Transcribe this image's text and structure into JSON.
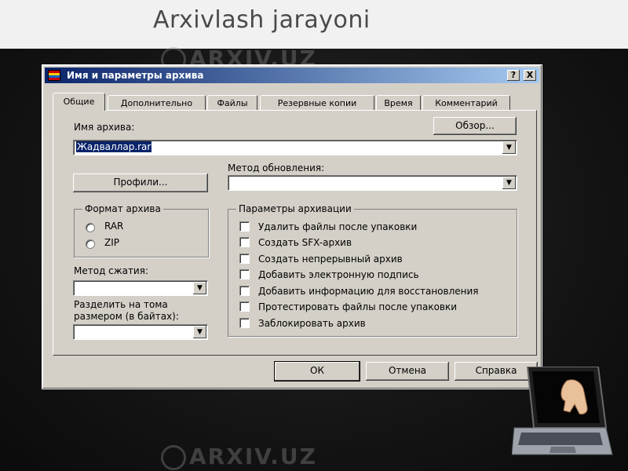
{
  "slide": {
    "title": "Arxivlash jarayoni",
    "watermark": "ARXIV.UZ"
  },
  "dialog": {
    "title": "Имя и параметры архива",
    "title_buttons": {
      "help": "?",
      "close": "X"
    },
    "tabs": [
      "Общие",
      "Дополнительно",
      "Файлы",
      "Резервные копии",
      "Время",
      "Комментарий"
    ],
    "archive_name_label": "Имя архива:",
    "archive_name_value": "Жадваллар.rar",
    "browse_button": "Обзор...",
    "profiles_button": "Профили...",
    "update_method_label": "Метод обновления:",
    "update_method_value": "",
    "format_group": {
      "title": "Формат архива",
      "options": [
        "RAR",
        "ZIP"
      ]
    },
    "options_group": {
      "title": "Параметры архивации",
      "items": [
        "Удалить файлы после упаковки",
        "Создать SFX-архив",
        "Создать непрерывный архив",
        "Добавить электронную подпись",
        "Добавить информацию для восстановления",
        "Протестировать файлы после упаковки",
        "Заблокировать архив"
      ]
    },
    "compression_label": "Метод сжатия:",
    "compression_value": "",
    "split_label_line1": "Разделить на тома",
    "split_label_line2": "размером (в байтах):",
    "split_value": "",
    "footer_buttons": {
      "ok": "ОК",
      "cancel": "Отмена",
      "help": "Справка"
    }
  },
  "colors": {
    "titlebar_start": "#0a246a",
    "titlebar_end": "#a6caf0",
    "dialog_face": "#d4d0c8"
  }
}
